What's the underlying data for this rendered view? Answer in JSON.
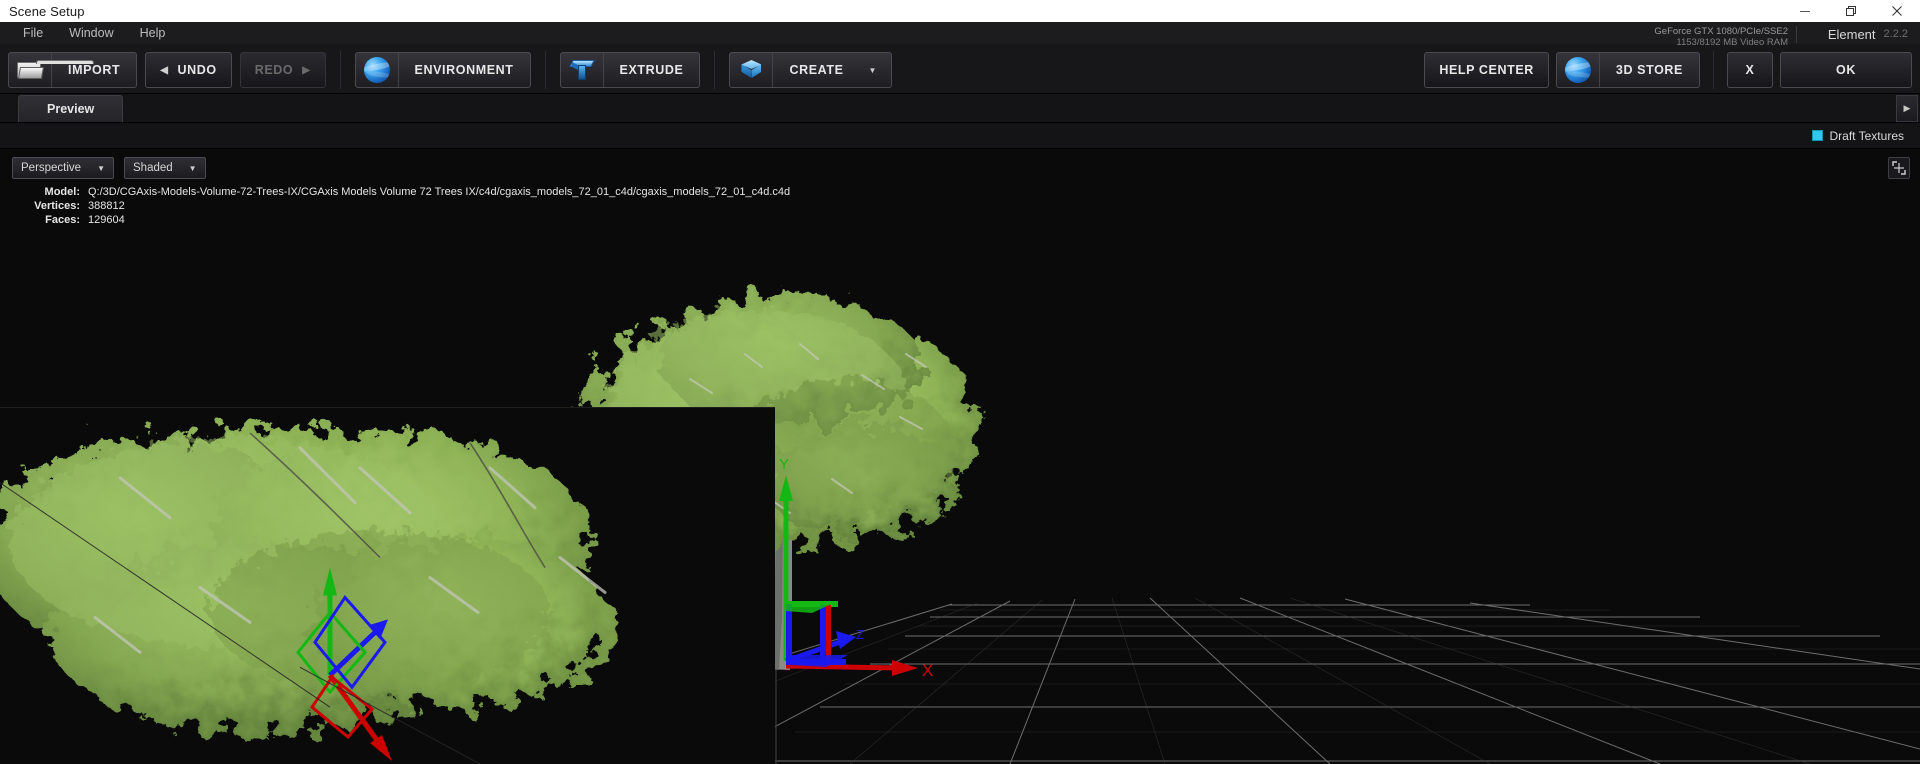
{
  "window": {
    "title": "Scene Setup",
    "controls": [
      {
        "name": "minimize",
        "glyph": "—"
      },
      {
        "name": "restore",
        "glyph": "❐"
      },
      {
        "name": "close",
        "glyph": "✕"
      }
    ]
  },
  "menu": {
    "items": [
      "File",
      "Window",
      "Help"
    ]
  },
  "status": {
    "gpu_line1": "GeForce GTX 1080/PCIe/SSE2",
    "gpu_line2": "1153/8192 MB Video RAM",
    "product_name": "Element",
    "product_version": "2.2.2"
  },
  "toolbar": {
    "import_label": "IMPORT",
    "undo_label": "UNDO",
    "redo_label": "REDO",
    "environment_label": "ENVIRONMENT",
    "extrude_label": "EXTRUDE",
    "create_label": "CREATE",
    "create_caret": "▼",
    "undo_arrow": "◀",
    "redo_arrow": "▶",
    "help_center_label": "HELP CENTER",
    "store_label": "3D STORE",
    "cancel_label": "X",
    "ok_label": "OK"
  },
  "tabs": {
    "items": [
      {
        "label": "Preview",
        "active": true
      }
    ],
    "scroll_right_glyph": "▶"
  },
  "options": {
    "draft_textures_label": "Draft Textures",
    "draft_textures_checked": true,
    "checkbox_color": "#2ec8f0"
  },
  "viewport": {
    "camera_mode": "Perspective",
    "shading_mode": "Shaded",
    "caret": "▼",
    "model_label": "Model:",
    "model_path": "Q:/3D/CGAxis-Models-Volume-72-Trees-IX/CGAxis Models Volume 72 Trees IX/c4d/cgaxis_models_72_01_c4d/cgaxis_models_72_01_c4d.c4d",
    "vertices_label": "Vertices:",
    "vertices_value": "388812",
    "faces_label": "Faces:",
    "faces_value": "129604",
    "axis_x_label": "X",
    "axis_y_label": "Y",
    "axis_z_label": "Z",
    "axis_x_color": "#cc0000",
    "axis_y_color": "#14b814",
    "axis_z_color": "#1a1aee",
    "background_color": "#0a0a0a",
    "grid_color": "#9a9a9a",
    "foliage_color": "#8fb457",
    "bark_color": "#8b8b86"
  }
}
